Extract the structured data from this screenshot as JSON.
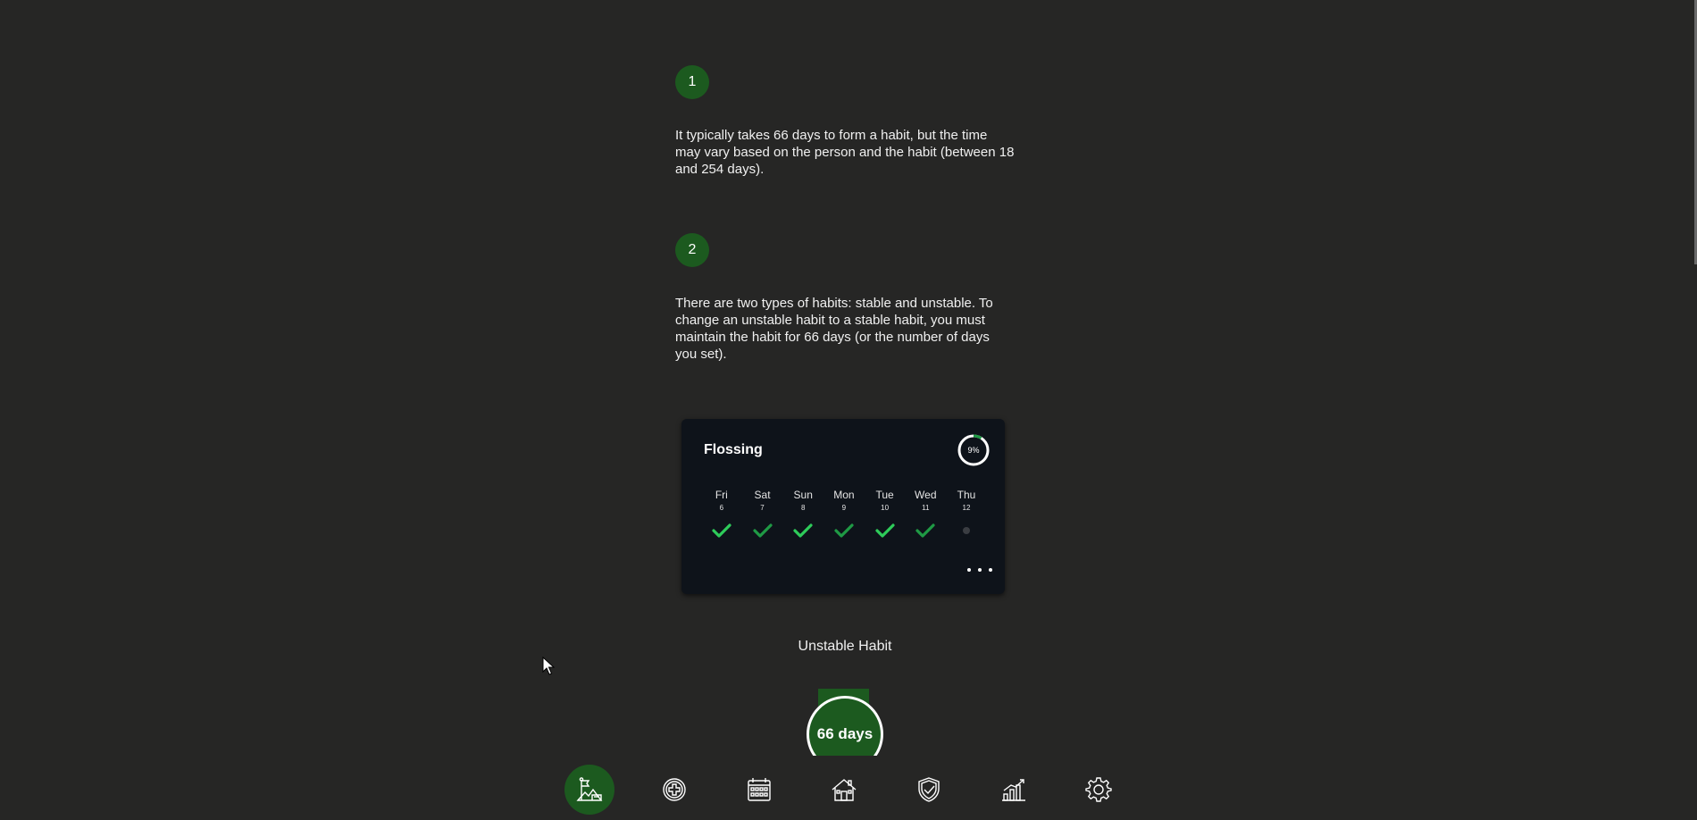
{
  "steps": [
    {
      "number": "1",
      "text": "It typically takes 66 days to form a habit, but the time may vary based on the person and the habit (between 18 and 254 days)."
    },
    {
      "number": "2",
      "text": "There are two types of habits: stable and unstable. To change an unstable habit to a stable habit, you must maintain the habit for 66 days (or the number of days you set)."
    }
  ],
  "habit_card": {
    "name": "Flossing",
    "progress_label": "9%",
    "progress_fraction": 0.09,
    "days": [
      {
        "name": "Fri",
        "num": "6",
        "status": "done"
      },
      {
        "name": "Sat",
        "num": "7",
        "status": "done"
      },
      {
        "name": "Sun",
        "num": "8",
        "status": "done"
      },
      {
        "name": "Mon",
        "num": "9",
        "status": "done"
      },
      {
        "name": "Tue",
        "num": "10",
        "status": "done"
      },
      {
        "name": "Wed",
        "num": "11",
        "status": "done"
      },
      {
        "name": "Thu",
        "num": "12",
        "status": "pending"
      }
    ],
    "more_icon": "more-horizontal-icon"
  },
  "habit_status": "Unstable Habit",
  "days_badge": "66 days",
  "nav": {
    "items": [
      {
        "id": "goal",
        "icon": "mountain-flag-icon",
        "active": true
      },
      {
        "id": "add",
        "icon": "plus-circle-icon",
        "active": false
      },
      {
        "id": "calendar",
        "icon": "calendar-icon",
        "active": false
      },
      {
        "id": "home",
        "icon": "house-icon",
        "active": false
      },
      {
        "id": "shield",
        "icon": "shield-check-icon",
        "active": false
      },
      {
        "id": "stats",
        "icon": "bar-chart-icon",
        "active": false
      },
      {
        "id": "settings",
        "icon": "gear-icon",
        "active": false
      }
    ]
  },
  "colors": {
    "background": "#262625",
    "accent_green": "#1c5a1f",
    "check_bright": "#2ecc5a",
    "check_dark": "#1f9a45",
    "card_bg": "#0e131a"
  }
}
